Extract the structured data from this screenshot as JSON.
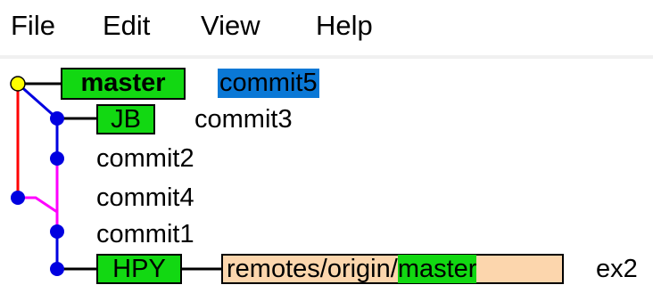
{
  "menu": {
    "file": "File",
    "edit": "Edit",
    "view": "View",
    "help": "Help"
  },
  "refs": {
    "master": "master",
    "jb": "JB",
    "hpy": "HPY",
    "remote_prefix": "remotes/origin/",
    "remote_branch": "master"
  },
  "commits": {
    "commit5": "commit5",
    "commit3": "commit3",
    "commit2": "commit2",
    "commit4": "commit4",
    "commit1": "commit1",
    "ex2": "ex2"
  },
  "colors": {
    "head_node": "#ffff00",
    "node": "#0000e0",
    "lane_red": "#ff0000",
    "lane_blue": "#0000e0",
    "lane_magenta": "#ff00ff",
    "local_branch": "#12d812",
    "remote_branch": "#fcd6ad",
    "selection": "#0a78d6"
  }
}
